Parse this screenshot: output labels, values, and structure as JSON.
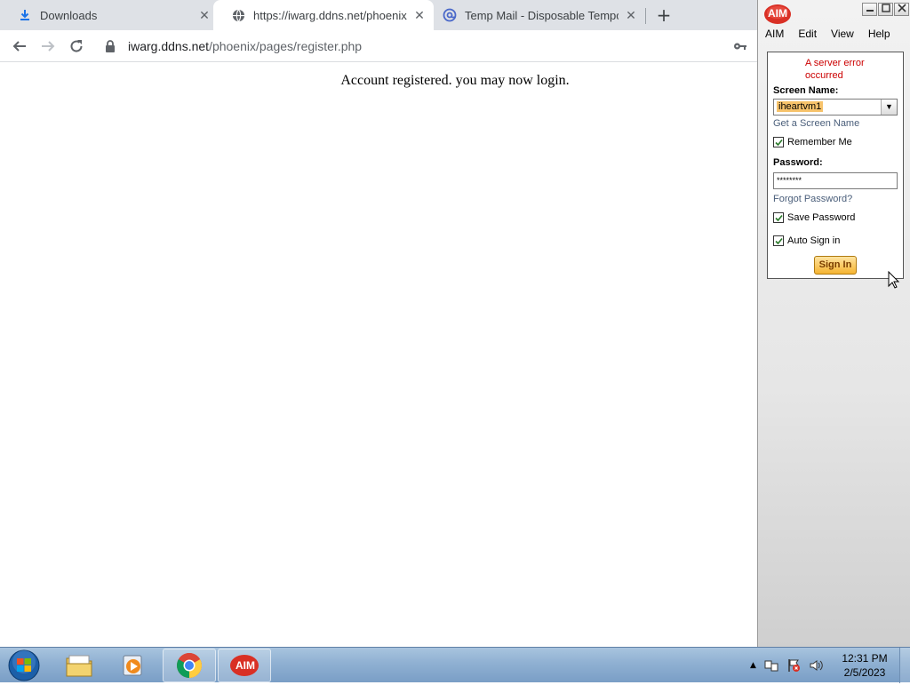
{
  "browser": {
    "tabs": [
      {
        "label": "Downloads",
        "icon": "download-icon",
        "active": false
      },
      {
        "label": "https://iwarg.ddns.net/phoenix/p",
        "icon": "globe-icon",
        "active": true
      },
      {
        "label": "Temp Mail - Disposable Tempora",
        "icon": "at-sign-icon",
        "active": false
      }
    ],
    "url_host": "iwarg.ddns.net",
    "url_path": "/phoenix/pages/register.php"
  },
  "page": {
    "message": "Account registered. you may now login."
  },
  "aim": {
    "logo_text": "AIM",
    "menu": [
      "AIM",
      "Edit",
      "View",
      "Help"
    ],
    "error": "A server error occurred",
    "screen_name_label": "Screen Name:",
    "screen_name_value": "iheartvm1",
    "get_screen_name": "Get a Screen Name",
    "remember_me": "Remember Me",
    "password_label": "Password:",
    "password_value": "********",
    "forgot_password": "Forgot Password?",
    "save_password": "Save Password",
    "auto_sign_in": "Auto Sign in",
    "sign_in": "Sign In"
  },
  "taskbar": {
    "time": "12:31 PM",
    "date": "2/5/2023",
    "aim_label": "AIM"
  }
}
